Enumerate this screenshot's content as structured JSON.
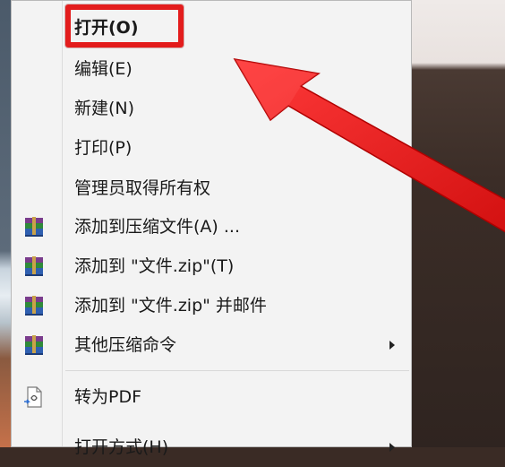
{
  "menu": {
    "items": [
      {
        "label": "打开(O)",
        "icon": "",
        "submenu": false,
        "bold": true
      },
      {
        "label": "编辑(E)",
        "icon": "",
        "submenu": false
      },
      {
        "label": "新建(N)",
        "icon": "",
        "submenu": false
      },
      {
        "label": "打印(P)",
        "icon": "",
        "submenu": false
      },
      {
        "label": "管理员取得所有权",
        "icon": "",
        "submenu": false
      },
      {
        "label": "添加到压缩文件(A) ...",
        "icon": "winrar-icon",
        "submenu": false
      },
      {
        "label": "添加到 \"文件.zip\"(T)",
        "icon": "winrar-icon",
        "submenu": false
      },
      {
        "label": "添加到 \"文件.zip\" 并邮件",
        "icon": "winrar-icon",
        "submenu": false
      },
      {
        "label": "其他压缩命令",
        "icon": "winrar-icon",
        "submenu": true
      },
      {
        "label": "转为PDF",
        "icon": "pdf-convert-icon",
        "submenu": false
      },
      {
        "label": "打开方式(H)",
        "icon": "",
        "submenu": true
      }
    ]
  },
  "annotation": {
    "highlight_color": "#e31c1c",
    "arrow_color": "#e31c1c"
  }
}
